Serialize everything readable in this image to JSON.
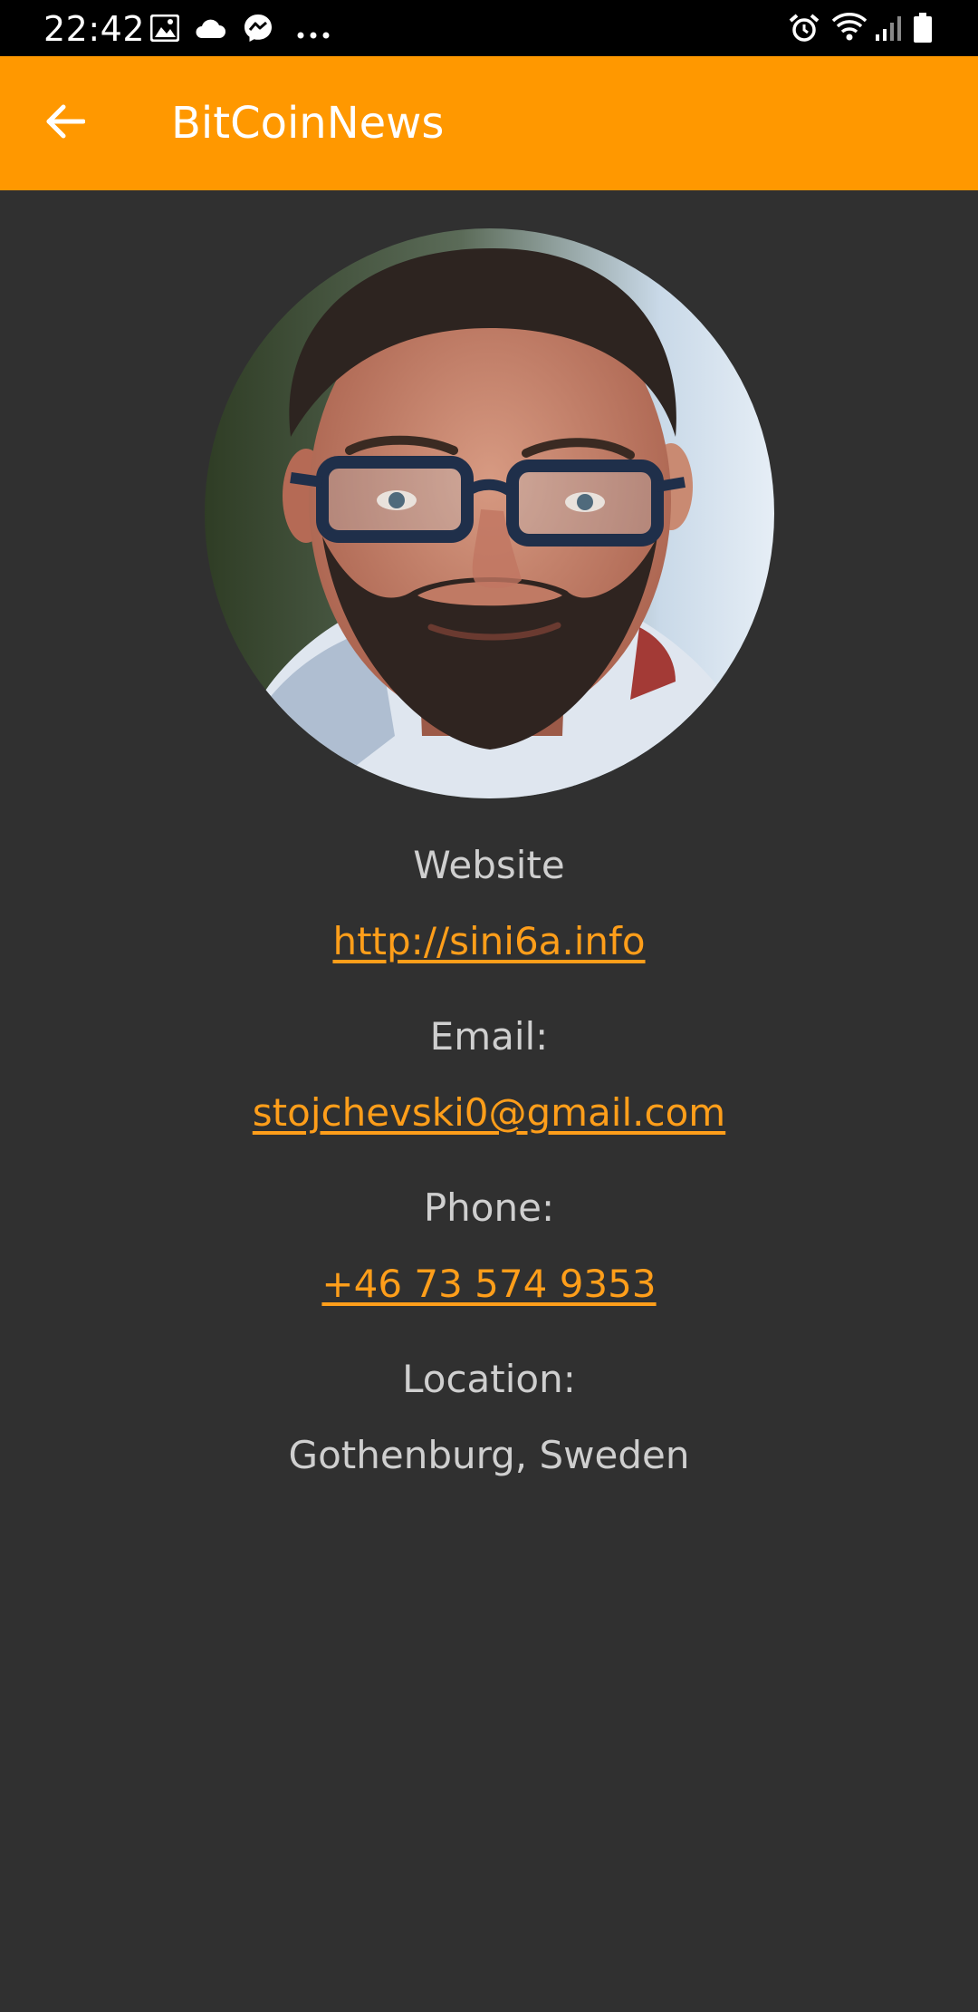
{
  "status_bar": {
    "time": "22:42",
    "left_icons": [
      "gallery-icon",
      "cloud-icon",
      "messenger-icon",
      "more-dots-icon"
    ],
    "right_icons": [
      "alarm-icon",
      "wifi-icon",
      "signal-icon",
      "battery-icon"
    ]
  },
  "app_bar": {
    "title": "BitCoinNews",
    "back_icon": "arrow-left-icon",
    "background": "#ff9800"
  },
  "profile": {
    "website_label": "Website",
    "website_value": "http://sini6a.info",
    "email_label": "Email:",
    "email_value": "stojchevski0@gmail.com",
    "phone_label": "Phone:",
    "phone_value": "+46 73 574 9353",
    "location_label": "Location:",
    "location_value": "Gothenburg, Sweden"
  },
  "colors": {
    "background": "#303030",
    "accent": "#ff9800",
    "link": "#ff9e1a",
    "text": "#cfcfcf"
  }
}
